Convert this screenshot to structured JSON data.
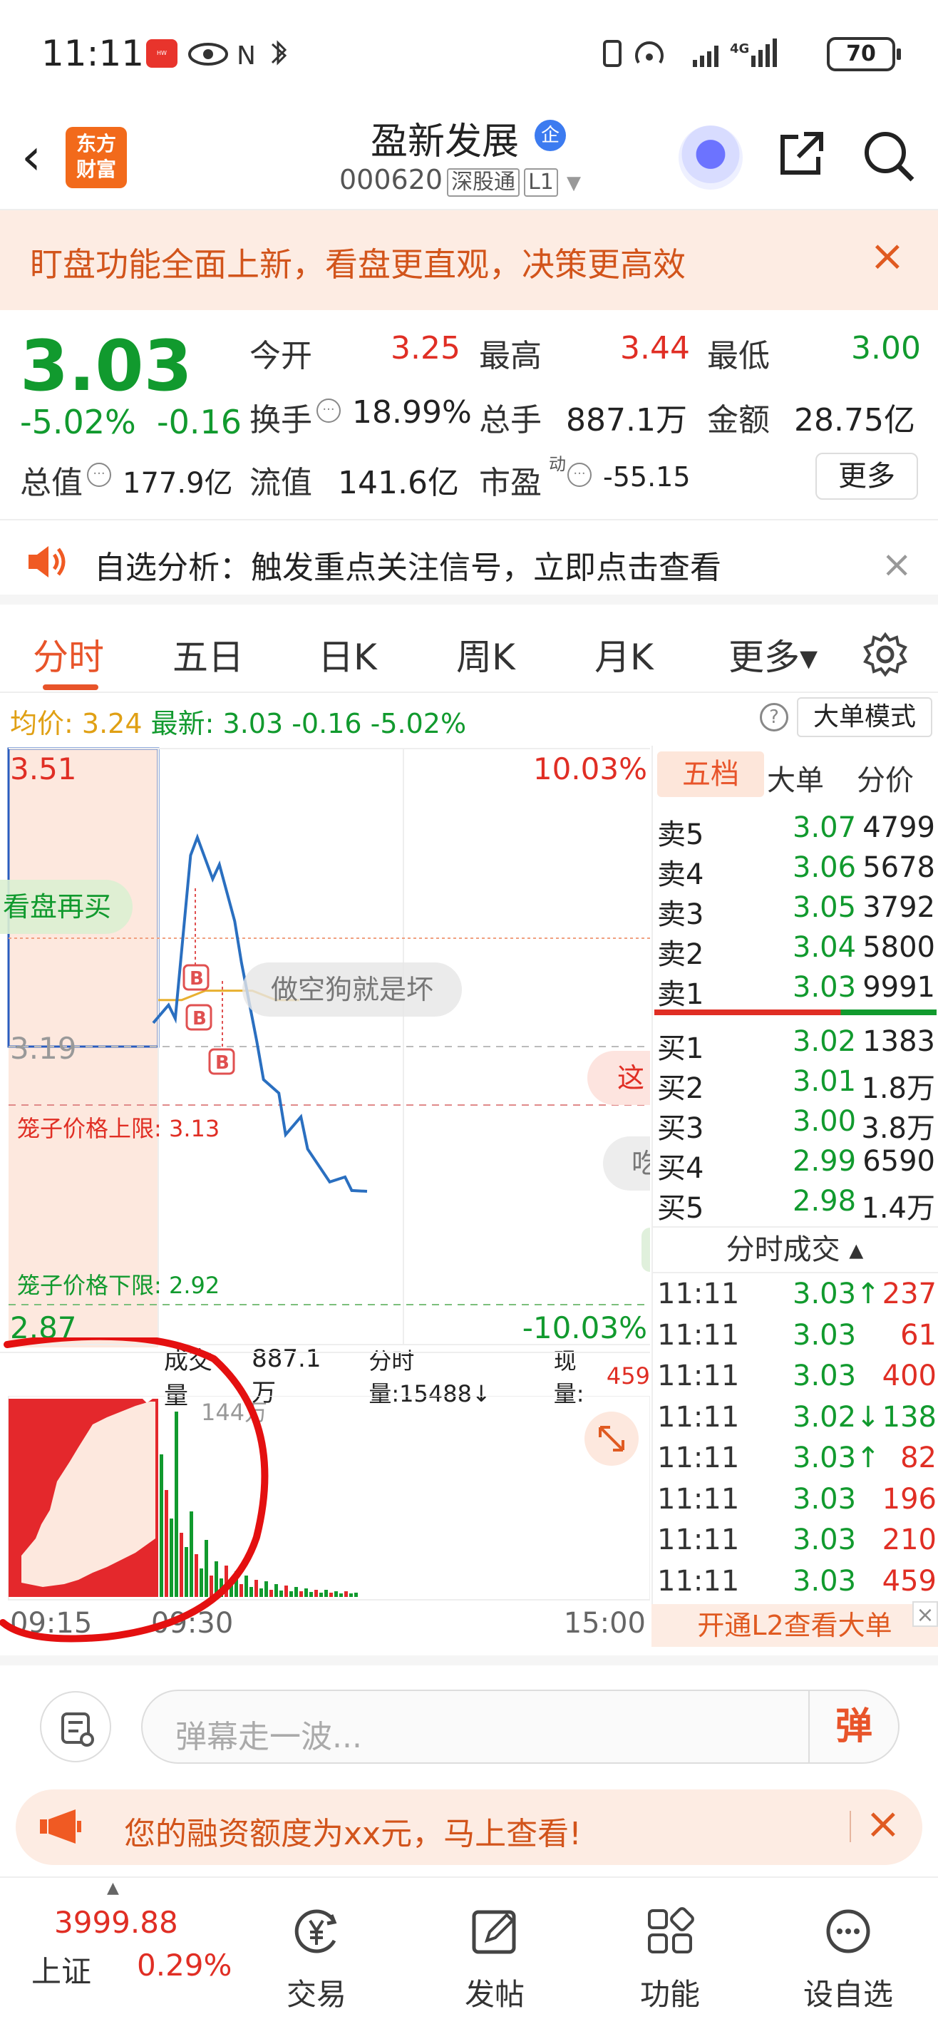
{
  "status_bar": {
    "time": "11:11",
    "battery": "70",
    "network": "4G"
  },
  "header": {
    "back": "‹",
    "logo": "东方\n财富",
    "stock_name": "盈新发展",
    "badge": "企",
    "code": "000620",
    "tag1": "深股通",
    "tag2": "L1"
  },
  "banner": {
    "text": "盯盘功能全面上新，看盘更直观，决策更高效",
    "close": "×"
  },
  "quote": {
    "price": "3.03",
    "pct": "-5.02%",
    "change": "-0.16",
    "open_label": "今开",
    "open": "3.25",
    "high_label": "最高",
    "high": "3.44",
    "low_label": "最低",
    "low": "3.00",
    "turnover_label": "换手",
    "turnover": "18.99%",
    "volume_label": "总手",
    "volume": "887.1万",
    "amount_label": "金额",
    "amount": "28.75亿",
    "mktcap_label": "总值",
    "mktcap": "177.9亿",
    "float_label": "流值",
    "float": "141.6亿",
    "pe_label": "市盈",
    "pe_sup": "动",
    "pe": "-55.15",
    "more": "更多"
  },
  "analysis": {
    "text": "自选分析：触发重点关注信号，立即点击查看",
    "close": "×"
  },
  "tabs": [
    "分时",
    "五日",
    "日K",
    "周K",
    "月K",
    "更多▾"
  ],
  "infoline": {
    "avg_label": "均价:",
    "avg": "3.24",
    "latest_label": "最新:",
    "latest": "3.03",
    "chg": "-0.16",
    "pct": "-5.02%",
    "big_order_mode": "大单模式",
    "help": "?"
  },
  "chart": {
    "y_top": "3.51",
    "y_top_pct": "10.03%",
    "y_mid": "3.19",
    "y_bot": "2.87",
    "y_bot_pct": "-10.03%",
    "cage_upper": "笼子价格上限: 3.13",
    "cage_lower": "笼子价格下限: 2.92",
    "danmu1": "做空狗就是坏",
    "danmu2": "看盘再买",
    "danmu3": "这",
    "danmu4": "吃",
    "marker": "B"
  },
  "chart_data": {
    "type": "line",
    "title": "",
    "ylim": [
      2.87,
      3.51
    ],
    "x": [
      "09:15",
      "09:30",
      "15:00"
    ],
    "price_points": [
      3.22,
      3.23,
      3.22,
      3.4,
      3.41,
      3.37,
      3.39,
      3.32,
      3.28,
      3.2,
      3.15,
      3.14,
      3.1,
      3.11,
      3.08,
      3.06,
      3.04,
      3.05,
      3.04,
      3.03
    ],
    "avg_points": [
      3.24,
      3.24,
      3.25,
      3.25,
      3.25,
      3.24,
      3.24
    ],
    "volume_max": "144万"
  },
  "volume": {
    "label": "成交量",
    "total": "887.1万",
    "tick_label": "分时量:15488↓",
    "now_label": "现量:",
    "now": "459",
    "max": "144万"
  },
  "x_axis": {
    "start": "09:15",
    "open": "09:30",
    "close": "15:00"
  },
  "orderbook": {
    "tabs": [
      "五档",
      "大单",
      "分价"
    ],
    "sells": [
      {
        "label": "卖5",
        "price": "3.07",
        "vol": "4799"
      },
      {
        "label": "卖4",
        "price": "3.06",
        "vol": "5678"
      },
      {
        "label": "卖3",
        "price": "3.05",
        "vol": "3792"
      },
      {
        "label": "卖2",
        "price": "3.04",
        "vol": "5800"
      },
      {
        "label": "卖1",
        "price": "3.03",
        "vol": "9991"
      }
    ],
    "buys": [
      {
        "label": "买1",
        "price": "3.02",
        "vol": "1383"
      },
      {
        "label": "买2",
        "price": "3.01",
        "vol": "1.8万"
      },
      {
        "label": "买3",
        "price": "3.00",
        "vol": "3.8万"
      },
      {
        "label": "买4",
        "price": "2.99",
        "vol": "6590"
      },
      {
        "label": "买5",
        "price": "2.98",
        "vol": "1.4万"
      }
    ],
    "trades_header": "分时成交 ▴",
    "trades": [
      {
        "time": "11:11",
        "price": "3.03↑",
        "vol": "237"
      },
      {
        "time": "11:11",
        "price": "3.03",
        "vol": "61"
      },
      {
        "time": "11:11",
        "price": "3.03",
        "vol": "400"
      },
      {
        "time": "11:11",
        "price": "3.02↓",
        "vol": "138"
      },
      {
        "time": "11:11",
        "price": "3.03↑",
        "vol": "82"
      },
      {
        "time": "11:11",
        "price": "3.03",
        "vol": "196"
      },
      {
        "time": "11:11",
        "price": "3.03",
        "vol": "210"
      },
      {
        "time": "11:11",
        "price": "3.03",
        "vol": "459"
      }
    ],
    "l2_link": "开通L2查看大单"
  },
  "comment": {
    "placeholder": "弹幕走一波...",
    "dan": "弹"
  },
  "finbar": {
    "text": "您的融资额度为xx元，马上查看!",
    "close": "×"
  },
  "bottom_nav": {
    "index_value": "3999.88",
    "index_name": "上证",
    "index_pct": "0.29%",
    "items": [
      "交易",
      "发帖",
      "功能",
      "设自选"
    ]
  }
}
